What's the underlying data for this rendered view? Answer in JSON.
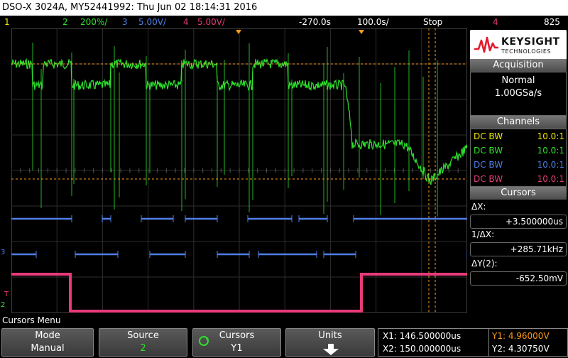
{
  "title": "DSO-X 3024A, MY52441992: Thu Jun 02 18:14:31 2016",
  "status": {
    "ch1_num": "1",
    "ch2": "2",
    "ch2_scale": "200%/",
    "ch3": "3",
    "ch3_scale": "5.00V/",
    "ch4": "4",
    "ch4_scale": "5.00V/",
    "delay": "-270.0s",
    "timebase": "100.0s/",
    "run_state": "Stop",
    "trigger_icon": "trigger-edge-icon",
    "trig_src": "4",
    "trig_level": "825"
  },
  "logo": {
    "brand": "KEYSIGHT",
    "sub": "TECHNOLOGIES"
  },
  "acquisition": {
    "header": "Acquisition",
    "mode": "Normal",
    "rate": "1.00GSa/s"
  },
  "channels": {
    "header": "Channels",
    "rows": [
      {
        "coupling": "DC BW",
        "ratio": "10.0:1",
        "color": "#f2e600"
      },
      {
        "coupling": "DC BW",
        "ratio": "10.0:1",
        "color": "#2ee02e"
      },
      {
        "coupling": "DC BW",
        "ratio": "10.0:1",
        "color": "#4f7fe8"
      },
      {
        "coupling": "DC BW",
        "ratio": "10.0:1",
        "color": "#e83a7a"
      }
    ]
  },
  "cursors": {
    "header": "Cursors",
    "dx_label": "ΔX:",
    "dx_value": "+3.500000us",
    "inv_dx_label": "1/ΔX:",
    "inv_dx_value": "+285.71kHz",
    "dy_label": "ΔY(2):",
    "dy_value": "-652.50mV"
  },
  "menu": {
    "title": "Cursors Menu",
    "softkeys": [
      {
        "title": "Mode",
        "value": "Manual"
      },
      {
        "title": "Source",
        "value": "2"
      },
      {
        "title": "Cursors",
        "value": "Y1"
      },
      {
        "title": "Units",
        "value": ""
      }
    ]
  },
  "readouts": {
    "x1": "X1: 146.500000us",
    "x2": "X2: 150.000000us",
    "y1": "Y1: 4.96000V",
    "y2": "Y2: 4.30750V"
  },
  "left_markers": {
    "ch3": "3",
    "ch2": "2",
    "trig": "T"
  },
  "colors": {
    "ch1": "#f2e600",
    "ch2": "#2ee02e",
    "ch3": "#4f7fe8",
    "ch4": "#e83a7a",
    "cursor": "#ff9a1a"
  }
}
